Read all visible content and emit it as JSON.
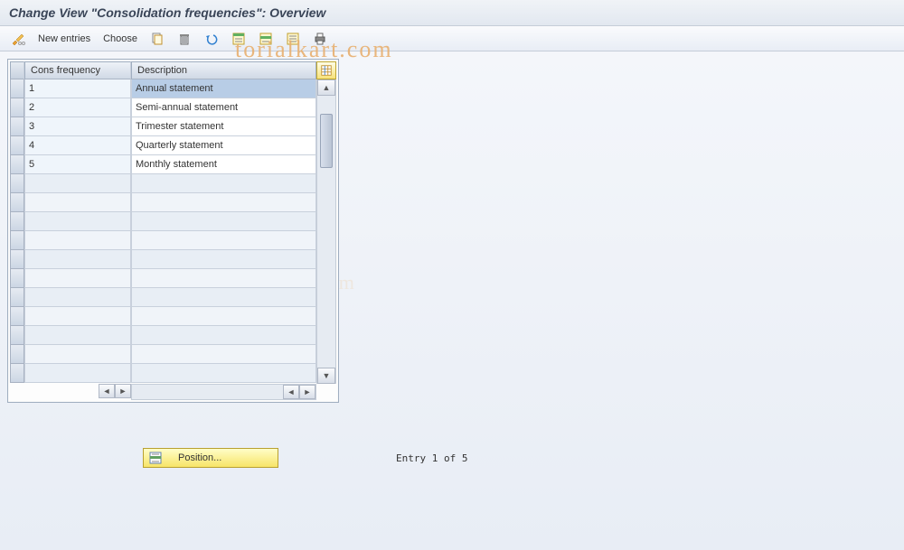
{
  "title": "Change View \"Consolidation frequencies\": Overview",
  "toolbar": {
    "new_entries": "New entries",
    "choose": "Choose"
  },
  "table": {
    "columns": {
      "freq": "Cons frequency",
      "desc": "Description"
    },
    "rows": [
      {
        "freq": "1",
        "desc": "Annual statement",
        "selected": true
      },
      {
        "freq": "2",
        "desc": "Semi-annual statement",
        "selected": false
      },
      {
        "freq": "3",
        "desc": "Trimester statement",
        "selected": false
      },
      {
        "freq": "4",
        "desc": "Quarterly statement",
        "selected": false
      },
      {
        "freq": "5",
        "desc": "Monthly statement",
        "selected": false
      }
    ],
    "empty_rows": 11
  },
  "footer": {
    "position_label": "Position...",
    "entry_text": "Entry 1 of 5"
  },
  "watermark_right": "torialkart.com",
  "watermark_center": "www.tutorialkart.com"
}
